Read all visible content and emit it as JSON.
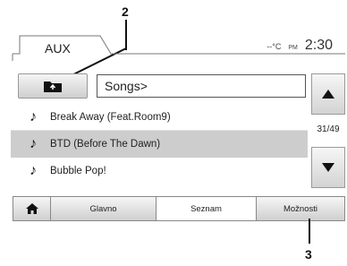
{
  "callouts": {
    "c2": "2",
    "c3": "3"
  },
  "header": {
    "source": "AUX",
    "temperature": "--°C",
    "pm": "PM",
    "time": "2:30"
  },
  "browser": {
    "path": "Songs>",
    "counter": "31/49"
  },
  "songs": [
    {
      "title": "Break Away (Feat.Room9)",
      "selected": false
    },
    {
      "title": "BTD (Before The Dawn)",
      "selected": true
    },
    {
      "title": "Bubble Pop!",
      "selected": false
    }
  ],
  "bottom_bar": {
    "glavno": "Glavno",
    "seznam": "Seznam",
    "moznosti": "Možnosti"
  },
  "icons": {
    "home": "home-icon",
    "folder_up": "folder-up-icon",
    "note": "music-note-icon"
  }
}
